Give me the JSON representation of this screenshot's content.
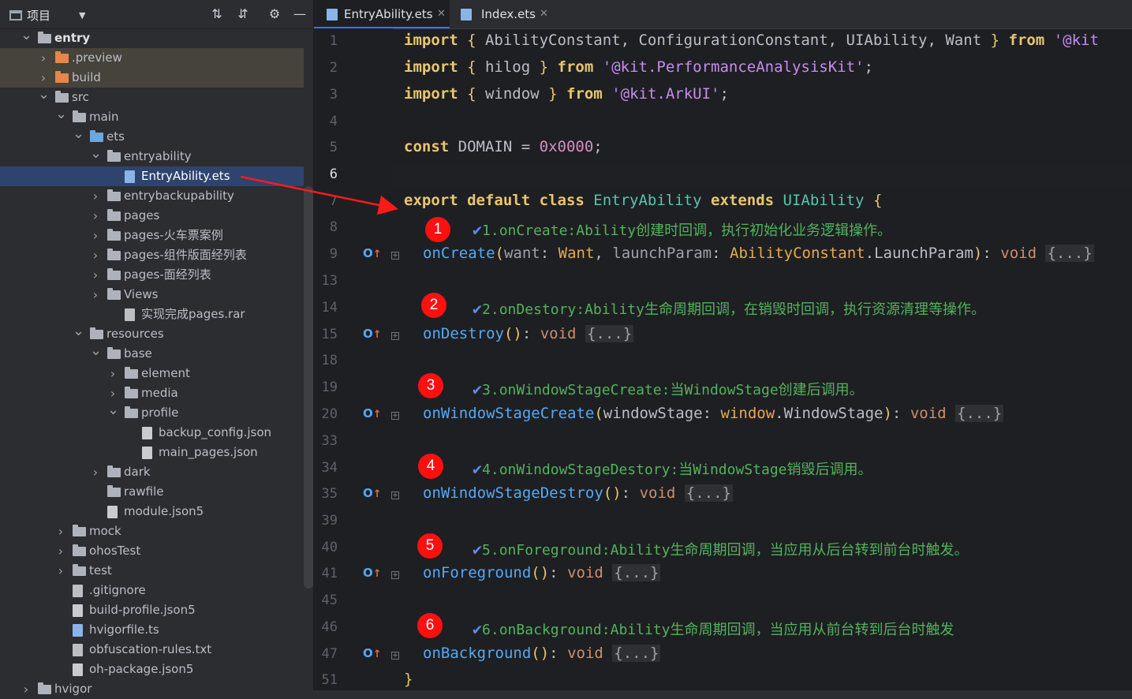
{
  "project_panel": {
    "title": "项目",
    "toolbar_icons": [
      "expand-all-icon",
      "collapse-all-icon",
      "gear-icon",
      "minimize-icon"
    ],
    "tree": [
      {
        "label": "entry",
        "depth": 0,
        "expanded": true,
        "kind": "module",
        "bold": true
      },
      {
        "label": ".preview",
        "depth": 1,
        "expanded": false,
        "kind": "folder-orange",
        "highlight": true
      },
      {
        "label": "build",
        "depth": 1,
        "expanded": false,
        "kind": "folder-orange",
        "highlight": true
      },
      {
        "label": "src",
        "depth": 1,
        "expanded": true,
        "kind": "folder"
      },
      {
        "label": "main",
        "depth": 2,
        "expanded": true,
        "kind": "folder"
      },
      {
        "label": "ets",
        "depth": 3,
        "expanded": true,
        "kind": "folder-blue"
      },
      {
        "label": "entryability",
        "depth": 4,
        "expanded": true,
        "kind": "folder"
      },
      {
        "label": "EntryAbility.ets",
        "depth": 5,
        "kind": "file-ets",
        "selected": true
      },
      {
        "label": "entrybackupability",
        "depth": 4,
        "expanded": false,
        "kind": "folder"
      },
      {
        "label": "pages",
        "depth": 4,
        "expanded": false,
        "kind": "folder"
      },
      {
        "label": "pages-火车票案例",
        "depth": 4,
        "expanded": false,
        "kind": "folder"
      },
      {
        "label": "pages-组件版面经列表",
        "depth": 4,
        "expanded": false,
        "kind": "folder"
      },
      {
        "label": "pages-面经列表",
        "depth": 4,
        "expanded": false,
        "kind": "folder"
      },
      {
        "label": "Views",
        "depth": 4,
        "expanded": false,
        "kind": "folder"
      },
      {
        "label": "实现完成pages.rar",
        "depth": 5,
        "kind": "file"
      },
      {
        "label": "resources",
        "depth": 3,
        "expanded": true,
        "kind": "folder"
      },
      {
        "label": "base",
        "depth": 4,
        "expanded": true,
        "kind": "folder"
      },
      {
        "label": "element",
        "depth": 5,
        "expanded": false,
        "kind": "folder"
      },
      {
        "label": "media",
        "depth": 5,
        "expanded": false,
        "kind": "folder"
      },
      {
        "label": "profile",
        "depth": 5,
        "expanded": true,
        "kind": "folder"
      },
      {
        "label": "backup_config.json",
        "depth": 6,
        "kind": "file-json"
      },
      {
        "label": "main_pages.json",
        "depth": 6,
        "kind": "file-json"
      },
      {
        "label": "dark",
        "depth": 4,
        "expanded": false,
        "kind": "folder"
      },
      {
        "label": "rawfile",
        "depth": 4,
        "kind": "folder"
      },
      {
        "label": "module.json5",
        "depth": 4,
        "kind": "file-json"
      },
      {
        "label": "mock",
        "depth": 2,
        "expanded": false,
        "kind": "folder"
      },
      {
        "label": "ohosTest",
        "depth": 2,
        "expanded": false,
        "kind": "folder"
      },
      {
        "label": "test",
        "depth": 2,
        "expanded": false,
        "kind": "folder"
      },
      {
        "label": ".gitignore",
        "depth": 2,
        "kind": "file"
      },
      {
        "label": "build-profile.json5",
        "depth": 2,
        "kind": "file-json"
      },
      {
        "label": "hvigorfile.ts",
        "depth": 2,
        "kind": "file-ets"
      },
      {
        "label": "obfuscation-rules.txt",
        "depth": 2,
        "kind": "file"
      },
      {
        "label": "oh-package.json5",
        "depth": 2,
        "kind": "file-json"
      },
      {
        "label": "hvigor",
        "depth": 0,
        "expanded": false,
        "kind": "folder"
      }
    ]
  },
  "tabs": [
    {
      "label": "EntryAbility.ets",
      "active": true
    },
    {
      "label": "Index.ets",
      "active": false
    }
  ],
  "line_numbers": [
    "1",
    "2",
    "3",
    "4",
    "5",
    "6",
    "7",
    "8",
    "9",
    "13",
    "14",
    "15",
    "18",
    "19",
    "20",
    "33",
    "34",
    "35",
    "39",
    "40",
    "41",
    "45",
    "46",
    "47",
    "51"
  ],
  "current_line": "6",
  "code": {
    "l1": {
      "kw": "import",
      "open": "{",
      "names": " AbilityConstant, ConfigurationConstant, UIAbility, Want ",
      "close": "}",
      "from": "from",
      "mod": "'@kit"
    },
    "l2": {
      "kw": "import",
      "open": "{",
      "names": " hilog ",
      "close": "}",
      "from": "from",
      "mod": "'@kit.PerformanceAnalysisKit'",
      "end": ";"
    },
    "l3": {
      "kw": "import",
      "open": "{",
      "names": " window ",
      "close": "}",
      "from": "from",
      "mod": "'@kit.ArkUI'",
      "end": ";"
    },
    "l5": {
      "kw": "const",
      "name": " DOMAIN ",
      "eq": "=",
      "num": "0x0000",
      "end": ";"
    },
    "l7": {
      "kw1": "export",
      "kw2": "default",
      "kw3": "class",
      "cls": "EntryAbility",
      "kw4": "extends",
      "base": "UIAbility",
      "brace": "{"
    },
    "l9": {
      "fn": "onCreate",
      "p1": "want",
      "t1": "Want",
      "p2": "launchParam",
      "t2ns": "AbilityConstant",
      "t2": "LaunchParam",
      "ret": "void",
      "body": "{...}"
    },
    "l15": {
      "fn": "onDestroy",
      "ret": "void",
      "body": "{...}"
    },
    "l20": {
      "fn": "onWindowStageCreate",
      "p1": "windowStage",
      "t1ns": "window",
      "t1": "WindowStage",
      "ret": "void",
      "body": "{...}"
    },
    "l35": {
      "fn": "onWindowStageDestroy",
      "ret": "void",
      "body": "{...}"
    },
    "l41": {
      "fn": "onForeground",
      "ret": "void",
      "body": "{...}"
    },
    "l47": {
      "fn": "onBackground",
      "ret": "void",
      "body": "{...}"
    },
    "l51": {
      "brace": "}"
    }
  },
  "annotations": [
    {
      "num": "1",
      "text": "1.onCreate:Ability创建时回调，执行初始化业务逻辑操作。"
    },
    {
      "num": "2",
      "text": "2.onDestory:Ability生命周期回调，在销毁时回调，执行资源清理等操作。"
    },
    {
      "num": "3",
      "text": "3.onWindowStageCreate:当WindowStage创建后调用。"
    },
    {
      "num": "4",
      "text": "4.onWindowStageDestory:当WindowStage销毁后调用。"
    },
    {
      "num": "5",
      "text": "5.onForeground:Ability生命周期回调，当应用从后台转到前台时触发。"
    },
    {
      "num": "6",
      "text": "6.onBackground:Ability生命周期回调，当应用从前台转到后台时触发"
    }
  ],
  "colors": {
    "badge": "#ff1010",
    "arrow": "#ff1a1a",
    "comment_green": "#52b35c",
    "keyword": "#e8c66f",
    "function": "#56a8f5",
    "string": "#c68cf0",
    "selection": "#2e436e"
  }
}
